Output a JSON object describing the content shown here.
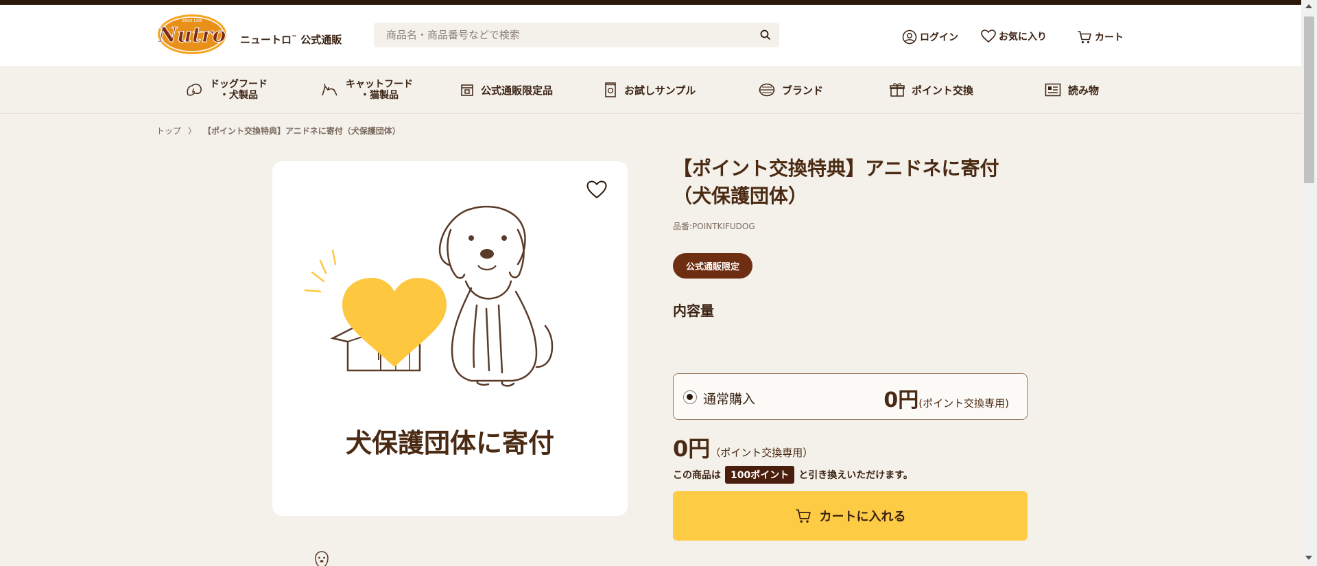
{
  "header": {
    "logo_text": "Nutro",
    "logo_since": "SINCE 1926",
    "brand_name": "ニュートロ",
    "brand_tm": "™",
    "brand_suffix": " 公式通販",
    "search_placeholder": "商品名・商品番号などで検索",
    "login_label": "ログイン",
    "favorites_label": "お気に入り",
    "cart_label": "カート"
  },
  "nav": {
    "dogfood_line1": "ドッグフード",
    "dogfood_line2": "・犬製品",
    "catfood_line1": "キャットフード",
    "catfood_line2": "・猫製品",
    "limited": "公式通販限定品",
    "sample": "お試しサンプル",
    "brand": "ブランド",
    "points": "ポイント交換",
    "reading": "読み物"
  },
  "breadcrumb": {
    "home": "トップ",
    "separator": "〉",
    "current": "【ポイント交換特典】アニドネに寄付（犬保護団体）"
  },
  "product": {
    "image_caption": "犬保護団体に寄付",
    "title": "【ポイント交換特典】アニドネに寄付（犬保護団体）",
    "code": "品番:POINTKIFUDOG",
    "badge": "公式通販限定",
    "volume_label": "内容量",
    "option_label": "通常購入",
    "option_price": "0円",
    "option_price_note": "(ポイント交換専用)",
    "price": "0円",
    "price_note": "（ポイント交換専用）",
    "points_prefix": "この商品は",
    "points_value": "100ポイント",
    "points_suffix": "と引き換えいただけます。",
    "cart_button": "カートに入れる"
  },
  "colors": {
    "brown_dark": "#4a2a12",
    "badge": "#6e2e12",
    "cart_yellow": "#fecb45",
    "heart_yellow": "#fdc840",
    "page_bg": "#f4f0ea"
  }
}
